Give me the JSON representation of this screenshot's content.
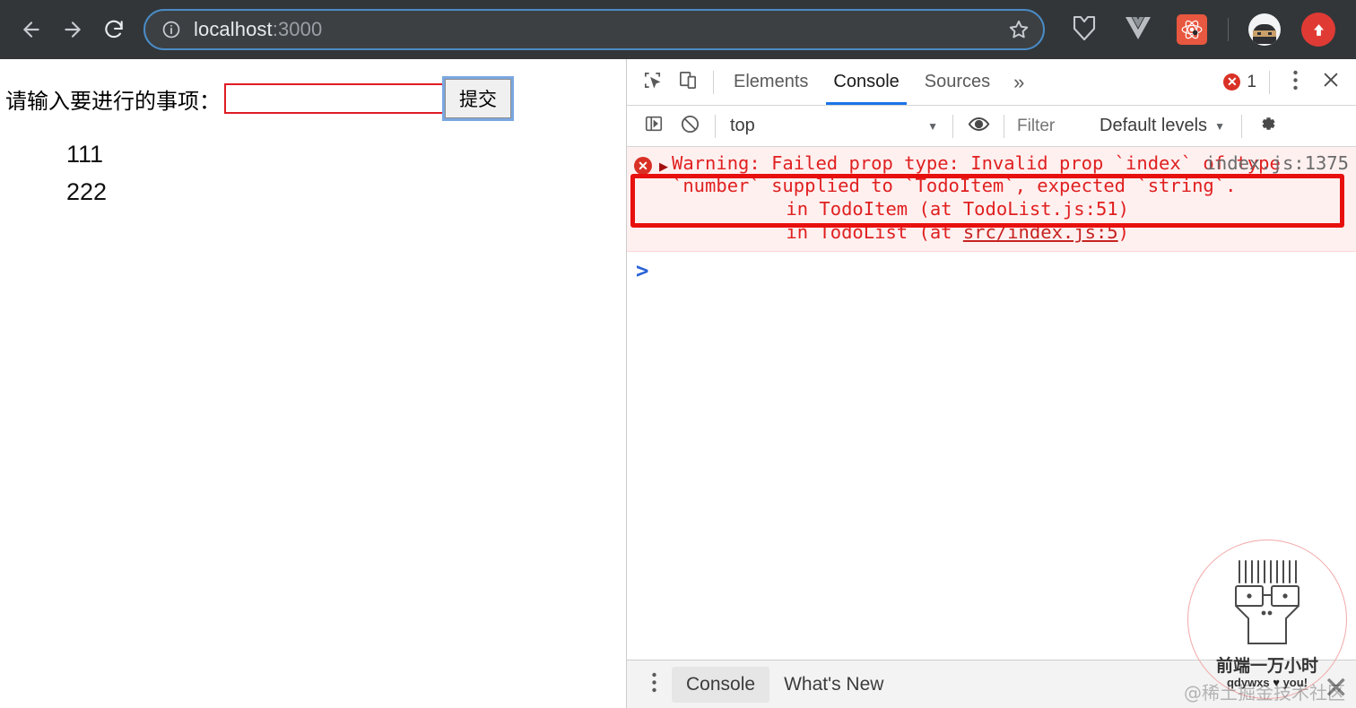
{
  "browser": {
    "back_icon": "arrow-left-icon",
    "forward_icon": "arrow-right-icon",
    "reload_icon": "reload-icon",
    "site_info_icon": "info-circle-icon",
    "url_host": "localhost",
    "url_port": ":3000",
    "bookmark_icon": "star-outline-icon",
    "extensions": [
      {
        "name": "momentum-shield-icon",
        "label": "M"
      },
      {
        "name": "vue-devtools-icon",
        "label": "V"
      },
      {
        "name": "react-devtools-icon",
        "label": "React"
      }
    ],
    "profile_icon": "ninja-avatar-icon",
    "upload_icon": "upload-arrow-icon"
  },
  "page": {
    "label": "请输入要进行的事项：",
    "input_value": "",
    "input_placeholder": "",
    "submit_label": "提交",
    "todos": [
      "111",
      "222"
    ]
  },
  "devtools": {
    "inspect_icon": "inspect-cursor-icon",
    "device_icon": "device-toggle-icon",
    "tabs": [
      {
        "label": "Elements",
        "active": false
      },
      {
        "label": "Console",
        "active": true
      },
      {
        "label": "Sources",
        "active": false
      }
    ],
    "more_tabs_icon": "chevron-double-right-icon",
    "error_badge_count": "1",
    "error_badge_icon": "error-circle-icon",
    "kebab_icon": "more-vertical-icon",
    "close_icon": "close-x-icon",
    "console_toolbar": {
      "sidebar_toggle_icon": "console-sidebar-icon",
      "clear_icon": "clear-console-icon",
      "context": "top",
      "context_caret": "▼",
      "eye_icon": "live-expression-eye-icon",
      "filter_placeholder": "Filter",
      "filter_value": "",
      "levels_label": "Default levels",
      "levels_caret": "▼",
      "settings_icon": "gear-icon"
    },
    "console_message": {
      "icon": "error-circle-icon",
      "disclosure": "▶",
      "text": "Warning: Failed prop type: Invalid prop `index` of type `number` supplied to `TodoItem`, expected `string`.",
      "source": "index.js:1375",
      "stack_line_1": "    in TodoItem (at TodoList.js:51)",
      "stack_line_2_prefix": "    in TodoList (at ",
      "stack_line_2_link": "src/index.js:5",
      "stack_line_2_suffix": ")"
    },
    "prompt_caret": ">",
    "drawer_tabs": [
      {
        "label": "Console",
        "active": true
      },
      {
        "label": "What's New",
        "active": false
      }
    ],
    "drawer_kebab_icon": "more-vertical-icon"
  },
  "watermark": {
    "title": "前端一万小时",
    "subtitle_prefix": "qdywxs ",
    "subtitle_heart": "♥",
    "subtitle_suffix": " you!",
    "overlay_text": "@稀土掘金技术社区",
    "close_mark": "✕",
    "circle_color": "#f2a8a8"
  },
  "colors": {
    "chrome_bg": "#323639",
    "omnibox_bg": "#3c4043",
    "omnibox_border": "#4a8cc7",
    "accent_blue": "#1a73e8",
    "error_red": "#d93025",
    "annotation_red": "#e8100e",
    "input_border_red": "#e01b24"
  }
}
